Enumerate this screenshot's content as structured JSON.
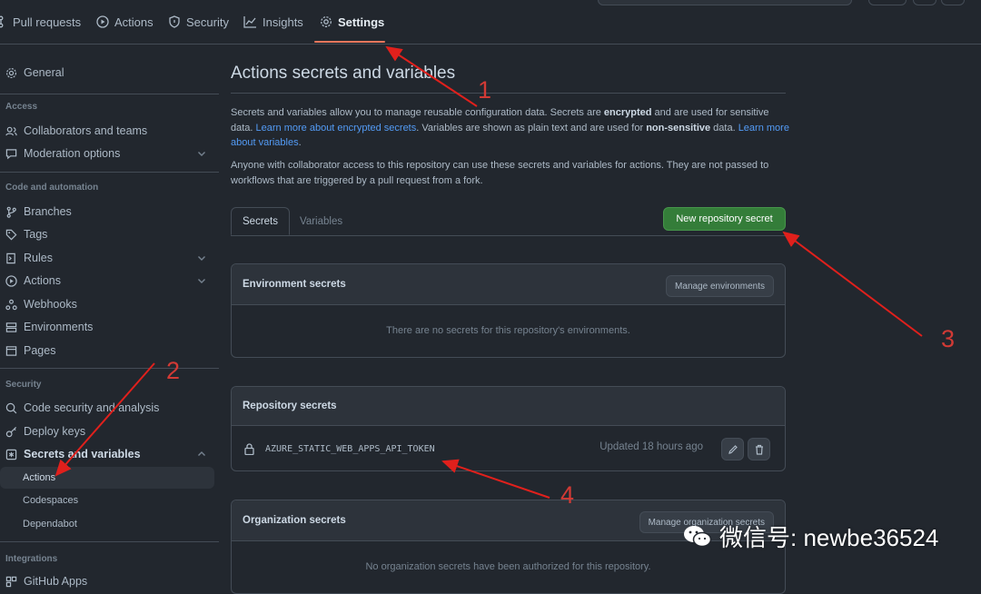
{
  "topnav": {
    "tabs": [
      {
        "label": "Pull requests",
        "icon": "pull-request-icon"
      },
      {
        "label": "Actions",
        "icon": "play-icon"
      },
      {
        "label": "Security",
        "icon": "shield-icon"
      },
      {
        "label": "Insights",
        "icon": "graph-icon"
      },
      {
        "label": "Settings",
        "icon": "gear-icon",
        "active": true
      }
    ]
  },
  "sidebar": {
    "general": "General",
    "access_heading": "Access",
    "collaborators": "Collaborators and teams",
    "moderation": "Moderation options",
    "code_heading": "Code and automation",
    "branches": "Branches",
    "tags": "Tags",
    "rules": "Rules",
    "actions": "Actions",
    "webhooks": "Webhooks",
    "environments": "Environments",
    "pages": "Pages",
    "security_heading": "Security",
    "code_security": "Code security and analysis",
    "deploy_keys": "Deploy keys",
    "secrets": "Secrets and variables",
    "sub_actions": "Actions",
    "sub_codespaces": "Codespaces",
    "sub_dependabot": "Dependabot",
    "integrations_heading": "Integrations",
    "github_apps": "GitHub Apps"
  },
  "main": {
    "title": "Actions secrets and variables",
    "p1": {
      "a": "Secrets and variables allow you to manage reusable configuration data. Secrets are ",
      "b": "encrypted",
      "c": " and are used for sensitive data. ",
      "link1": "Learn more about encrypted secrets",
      "d": ". Variables are shown as plain text and are used for ",
      "e": "non-sensitive",
      "f": " data. ",
      "link2": "Learn more about variables",
      "g": "."
    },
    "p2": "Anyone with collaborator access to this repository can use these secrets and variables for actions. They are not passed to workflows that are triggered by a pull request from a fork.",
    "tabs": {
      "secrets": "Secrets",
      "variables": "Variables"
    },
    "new_secret_button": "New repository secret",
    "env_box": {
      "title": "Environment secrets",
      "button": "Manage environments",
      "empty": "There are no secrets for this repository's environments."
    },
    "repo_box": {
      "title": "Repository secrets",
      "secret_name": "AZURE_STATIC_WEB_APPS_API_TOKEN",
      "updated": "Updated 18 hours ago"
    },
    "org_box": {
      "title": "Organization secrets",
      "button": "Manage organization secrets",
      "empty": "No organization secrets have been authorized for this repository."
    }
  },
  "annotations": {
    "n1": "1",
    "n2": "2",
    "n3": "3",
    "n4": "4",
    "arrow_color": "#e0201c"
  },
  "watermark": {
    "text": "微信号: newbe36524"
  },
  "colors": {
    "accent": "#ec775c",
    "link": "#539bf5",
    "green": "#347d39",
    "bg": "#22272e"
  }
}
